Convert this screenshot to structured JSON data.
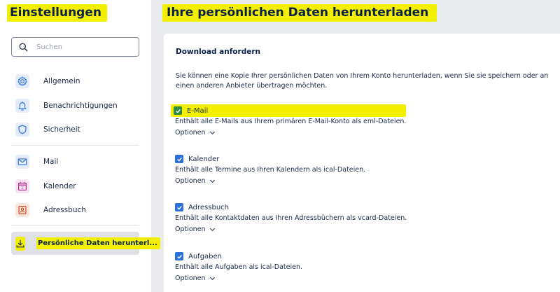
{
  "sidebar": {
    "title": "Einstellungen",
    "search_placeholder": "Suchen",
    "items": [
      {
        "label": "Allgemein",
        "icon": "gear-icon"
      },
      {
        "label": "Benachrichtigungen",
        "icon": "bell-icon"
      },
      {
        "label": "Sicherheit",
        "icon": "shield-icon"
      },
      {
        "label": "Mail",
        "icon": "mail-icon"
      },
      {
        "label": "Kalender",
        "icon": "calendar-icon"
      },
      {
        "label": "Adressbuch",
        "icon": "addressbook-icon"
      },
      {
        "label": "Persönliche Daten herunterl...",
        "icon": "download-icon",
        "active": true
      }
    ]
  },
  "main": {
    "title": "Ihre persönlichen Daten herunterladen",
    "section_heading": "Download anfordern",
    "intro": "Sie können eine Kopie Ihrer persönlichen Daten von Ihrem Konto herunterladen, wenn Sie sie speichern oder an einen anderen Anbieter übertragen möchten.",
    "options": [
      {
        "name": "E-Mail",
        "desc": "Enthält alle E-Mails aus Ihrem primären E-Mail-Konto als eml-Dateien.",
        "more": "Optionen",
        "checked": true
      },
      {
        "name": "Kalender",
        "desc": "Enthält alle Termine aus Ihren Kalendern als ical-Dateien.",
        "more": "Optionen",
        "checked": true
      },
      {
        "name": "Adressbuch",
        "desc": "Enthält alle Kontaktdaten aus Ihren Adressbüchern als vcard-Dateien.",
        "more": "Optionen",
        "checked": true
      },
      {
        "name": "Aufgaben",
        "desc": "Enthält alle Aufgaben als ical-Dateien.",
        "more": "Optionen",
        "checked": true
      }
    ]
  },
  "colors": {
    "highlight": "#f2f000",
    "navy": "#0b1f4b",
    "checkbox_blue": "#2c72d6",
    "checkbox_green": "#2d8a3c",
    "active_bg": "#dfe1e6"
  }
}
